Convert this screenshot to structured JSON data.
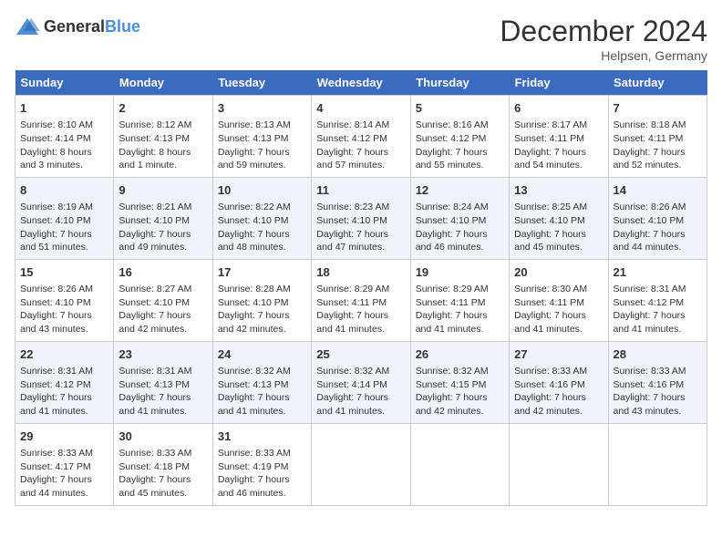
{
  "header": {
    "logo_general": "General",
    "logo_blue": "Blue",
    "month_title": "December 2024",
    "location": "Helpsen, Germany"
  },
  "days_of_week": [
    "Sunday",
    "Monday",
    "Tuesday",
    "Wednesday",
    "Thursday",
    "Friday",
    "Saturday"
  ],
  "weeks": [
    [
      {
        "day": 1,
        "sunrise": "8:10 AM",
        "sunset": "4:14 PM",
        "daylight": "8 hours and 3 minutes."
      },
      {
        "day": 2,
        "sunrise": "8:12 AM",
        "sunset": "4:13 PM",
        "daylight": "8 hours and 1 minute."
      },
      {
        "day": 3,
        "sunrise": "8:13 AM",
        "sunset": "4:13 PM",
        "daylight": "7 hours and 59 minutes."
      },
      {
        "day": 4,
        "sunrise": "8:14 AM",
        "sunset": "4:12 PM",
        "daylight": "7 hours and 57 minutes."
      },
      {
        "day": 5,
        "sunrise": "8:16 AM",
        "sunset": "4:12 PM",
        "daylight": "7 hours and 55 minutes."
      },
      {
        "day": 6,
        "sunrise": "8:17 AM",
        "sunset": "4:11 PM",
        "daylight": "7 hours and 54 minutes."
      },
      {
        "day": 7,
        "sunrise": "8:18 AM",
        "sunset": "4:11 PM",
        "daylight": "7 hours and 52 minutes."
      }
    ],
    [
      {
        "day": 8,
        "sunrise": "8:19 AM",
        "sunset": "4:10 PM",
        "daylight": "7 hours and 51 minutes."
      },
      {
        "day": 9,
        "sunrise": "8:21 AM",
        "sunset": "4:10 PM",
        "daylight": "7 hours and 49 minutes."
      },
      {
        "day": 10,
        "sunrise": "8:22 AM",
        "sunset": "4:10 PM",
        "daylight": "7 hours and 48 minutes."
      },
      {
        "day": 11,
        "sunrise": "8:23 AM",
        "sunset": "4:10 PM",
        "daylight": "7 hours and 47 minutes."
      },
      {
        "day": 12,
        "sunrise": "8:24 AM",
        "sunset": "4:10 PM",
        "daylight": "7 hours and 46 minutes."
      },
      {
        "day": 13,
        "sunrise": "8:25 AM",
        "sunset": "4:10 PM",
        "daylight": "7 hours and 45 minutes."
      },
      {
        "day": 14,
        "sunrise": "8:26 AM",
        "sunset": "4:10 PM",
        "daylight": "7 hours and 44 minutes."
      }
    ],
    [
      {
        "day": 15,
        "sunrise": "8:26 AM",
        "sunset": "4:10 PM",
        "daylight": "7 hours and 43 minutes."
      },
      {
        "day": 16,
        "sunrise": "8:27 AM",
        "sunset": "4:10 PM",
        "daylight": "7 hours and 42 minutes."
      },
      {
        "day": 17,
        "sunrise": "8:28 AM",
        "sunset": "4:10 PM",
        "daylight": "7 hours and 42 minutes."
      },
      {
        "day": 18,
        "sunrise": "8:29 AM",
        "sunset": "4:11 PM",
        "daylight": "7 hours and 41 minutes."
      },
      {
        "day": 19,
        "sunrise": "8:29 AM",
        "sunset": "4:11 PM",
        "daylight": "7 hours and 41 minutes."
      },
      {
        "day": 20,
        "sunrise": "8:30 AM",
        "sunset": "4:11 PM",
        "daylight": "7 hours and 41 minutes."
      },
      {
        "day": 21,
        "sunrise": "8:31 AM",
        "sunset": "4:12 PM",
        "daylight": "7 hours and 41 minutes."
      }
    ],
    [
      {
        "day": 22,
        "sunrise": "8:31 AM",
        "sunset": "4:12 PM",
        "daylight": "7 hours and 41 minutes."
      },
      {
        "day": 23,
        "sunrise": "8:31 AM",
        "sunset": "4:13 PM",
        "daylight": "7 hours and 41 minutes."
      },
      {
        "day": 24,
        "sunrise": "8:32 AM",
        "sunset": "4:13 PM",
        "daylight": "7 hours and 41 minutes."
      },
      {
        "day": 25,
        "sunrise": "8:32 AM",
        "sunset": "4:14 PM",
        "daylight": "7 hours and 41 minutes."
      },
      {
        "day": 26,
        "sunrise": "8:32 AM",
        "sunset": "4:15 PM",
        "daylight": "7 hours and 42 minutes."
      },
      {
        "day": 27,
        "sunrise": "8:33 AM",
        "sunset": "4:16 PM",
        "daylight": "7 hours and 42 minutes."
      },
      {
        "day": 28,
        "sunrise": "8:33 AM",
        "sunset": "4:16 PM",
        "daylight": "7 hours and 43 minutes."
      }
    ],
    [
      {
        "day": 29,
        "sunrise": "8:33 AM",
        "sunset": "4:17 PM",
        "daylight": "7 hours and 44 minutes."
      },
      {
        "day": 30,
        "sunrise": "8:33 AM",
        "sunset": "4:18 PM",
        "daylight": "7 hours and 45 minutes."
      },
      {
        "day": 31,
        "sunrise": "8:33 AM",
        "sunset": "4:19 PM",
        "daylight": "7 hours and 46 minutes."
      },
      null,
      null,
      null,
      null
    ]
  ]
}
